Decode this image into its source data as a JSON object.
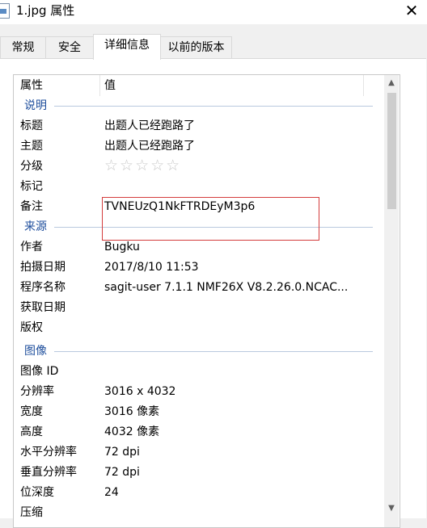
{
  "window": {
    "title": "1.jpg 属性",
    "close_glyph": "✕"
  },
  "tabs": [
    {
      "label": "常规",
      "active": false
    },
    {
      "label": "安全",
      "active": false
    },
    {
      "label": "详细信息",
      "active": true
    },
    {
      "label": "以前的版本",
      "active": false
    }
  ],
  "columns": {
    "property": "属性",
    "value": "值"
  },
  "groups": {
    "description": "说明",
    "origin": "来源",
    "image": "图像"
  },
  "description": {
    "title_key": "标题",
    "title_val": "出题人已经跑路了",
    "subject_key": "主题",
    "subject_val": "出题人已经跑路了",
    "rating_key": "分级",
    "rating_stars": "☆☆☆☆☆",
    "rating_value": 0,
    "tags_key": "标记",
    "tags_val": "",
    "comments_key": "备注",
    "comments_val": "TVNEUzQ1NkFTRDEyM3p6"
  },
  "origin": {
    "author_key": "作者",
    "author_val": "Bugku",
    "date_taken_key": "拍摄日期",
    "date_taken_val": "2017/8/10 11:53",
    "program_key": "程序名称",
    "program_val": "sagit-user 7.1.1 NMF26X V8.2.26.0.NCAC...",
    "date_acquired_key": "获取日期",
    "date_acquired_val": "",
    "copyright_key": "版权",
    "copyright_val": ""
  },
  "image": {
    "id_key": "图像 ID",
    "id_val": "",
    "dimensions_key": "分辨率",
    "dimensions_val": "3016 x 4032",
    "width_key": "宽度",
    "width_val": "3016 像素",
    "height_key": "高度",
    "height_val": "4032 像素",
    "hres_key": "水平分辨率",
    "hres_val": "72 dpi",
    "vres_key": "垂直分辨率",
    "vres_val": "72 dpi",
    "bitdepth_key": "位深度",
    "bitdepth_val": "24",
    "compression_key": "压缩",
    "compression_val": ""
  },
  "scrollbar": {
    "up_glyph": "▲",
    "down_glyph": "▼"
  }
}
